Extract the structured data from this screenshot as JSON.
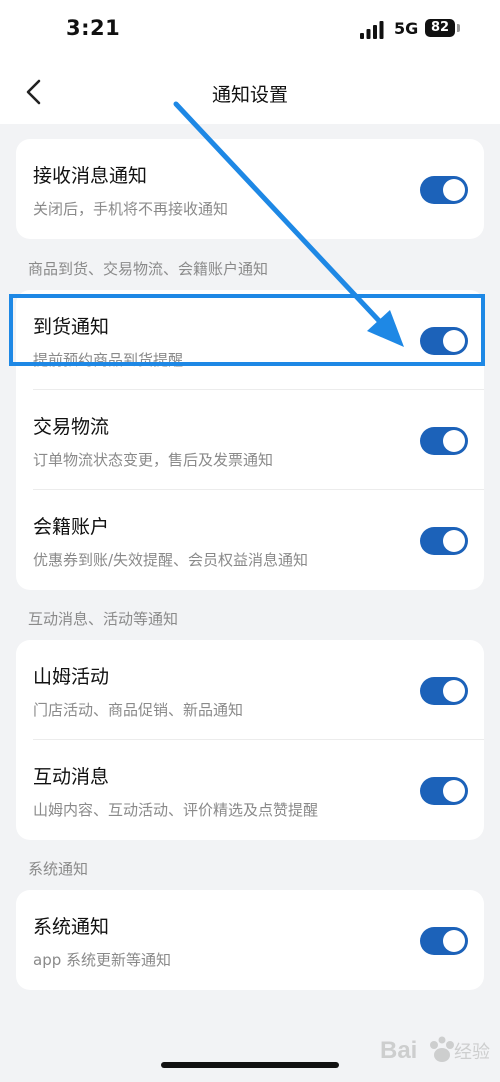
{
  "status_bar": {
    "time": "3:21",
    "network": "5G",
    "battery": "82"
  },
  "nav": {
    "title": "通知设置"
  },
  "sections": {
    "main": {
      "items": [
        {
          "title": "接收消息通知",
          "subtitle": "关闭后，手机将不再接收通知",
          "enabled": true
        }
      ]
    },
    "goods": {
      "label": "商品到货、交易物流、会籍账户通知",
      "items": [
        {
          "title": "到货通知",
          "subtitle": "提前预约商品到货提醒",
          "enabled": true
        },
        {
          "title": "交易物流",
          "subtitle": "订单物流状态变更，售后及发票通知",
          "enabled": true
        },
        {
          "title": "会籍账户",
          "subtitle": "优惠券到账/失效提醒、会员权益消息通知",
          "enabled": true
        }
      ]
    },
    "interact": {
      "label": "互动消息、活动等通知",
      "items": [
        {
          "title": "山姆活动",
          "subtitle": "门店活动、商品促销、新品通知",
          "enabled": true
        },
        {
          "title": "互动消息",
          "subtitle": "山姆内容、互动活动、评价精选及点赞提醒",
          "enabled": true
        }
      ]
    },
    "system": {
      "label": "系统通知",
      "items": [
        {
          "title": "系统通知",
          "subtitle": "app 系统更新等通知",
          "enabled": true
        }
      ]
    }
  },
  "colors": {
    "toggle_on": "#1c62b9",
    "highlight": "#1e88e5",
    "background": "#f2f3f5"
  },
  "icons": {
    "back": "chevron-left-icon",
    "signal": "signal-bars-icon",
    "battery": "battery-icon"
  }
}
